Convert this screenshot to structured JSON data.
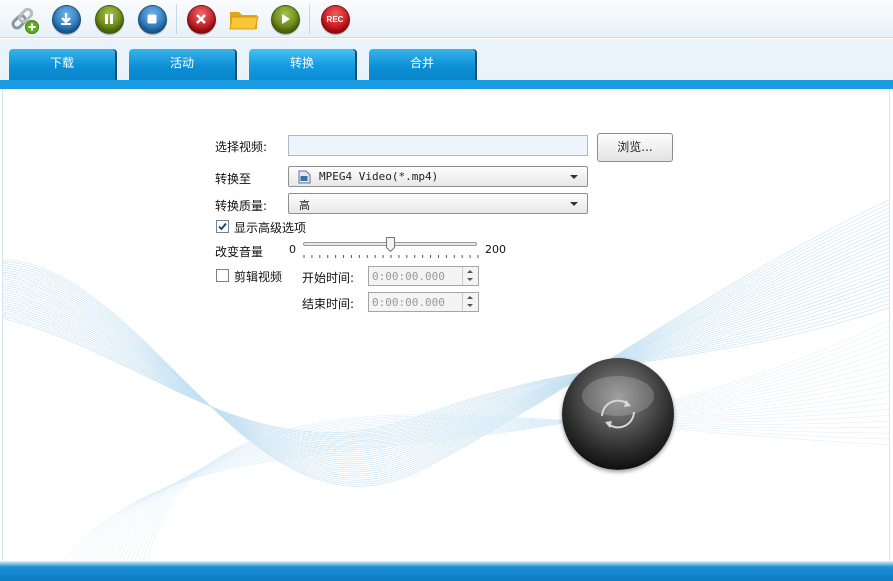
{
  "toolbar": {
    "buttons": [
      {
        "name": "add-link",
        "icon": "link-add-icon"
      },
      {
        "name": "download",
        "icon": "download-icon",
        "color": "#2c7fc0"
      },
      {
        "name": "pause",
        "icon": "pause-icon",
        "color": "#6f8b16"
      },
      {
        "name": "stop",
        "icon": "stop-icon",
        "color": "#2c7fc0"
      },
      {
        "name": "delete",
        "icon": "close-icon",
        "color": "#c8161d"
      },
      {
        "name": "open-folder",
        "icon": "folder-icon",
        "color": "#f0b21c"
      },
      {
        "name": "play",
        "icon": "play-icon",
        "color": "#6f8b16"
      },
      {
        "name": "record",
        "icon": "record-icon",
        "label": "REC",
        "color": "#d4121a"
      }
    ]
  },
  "tabs": [
    {
      "label": "下载",
      "active": false
    },
    {
      "label": "活动",
      "active": false
    },
    {
      "label": "转换",
      "active": true
    },
    {
      "label": "合并",
      "active": false
    }
  ],
  "convert": {
    "select_video_label": "选择视频:",
    "video_path": "",
    "browse_label": "浏览...",
    "convert_to_label": "转换至",
    "convert_to_value": "MPEG4 Video(*.mp4)",
    "quality_label": "转换质量:",
    "quality_value": "高",
    "show_advanced_label": "显示高级选项",
    "show_advanced_checked": true,
    "volume_label": "改变音量",
    "volume_min": "0",
    "volume_max": "200",
    "volume_value": 100,
    "trim_label": "剪辑视频",
    "trim_checked": false,
    "start_time_label": "开始时间:",
    "start_time_value": "0:00:00.000",
    "end_time_label": "结束时间:",
    "end_time_value": "0:00:00.000"
  },
  "colors": {
    "tab_blue": "#0b8fd6",
    "accent_blue": "#1a9ae0"
  }
}
